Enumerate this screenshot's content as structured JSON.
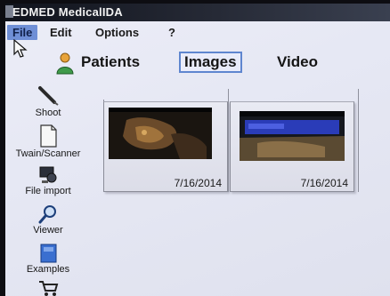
{
  "window": {
    "title": "EDMED MedicalIDA"
  },
  "menu": [
    {
      "label": "File"
    },
    {
      "label": "Edit"
    },
    {
      "label": "Options"
    },
    {
      "label": "?"
    }
  ],
  "tabs": [
    {
      "label": "Patients",
      "icon": "person-icon"
    },
    {
      "label": "Images",
      "active": true
    },
    {
      "label": "Video"
    }
  ],
  "sidebar": [
    {
      "label": "Shoot",
      "icon": "pen-icon"
    },
    {
      "label": "Twain/Scanner",
      "icon": "document-icon"
    },
    {
      "label": "File import",
      "icon": "import-icon"
    },
    {
      "label": "Viewer",
      "icon": "magnifier-icon"
    },
    {
      "label": "Examples",
      "icon": "book-icon"
    },
    {
      "label": "",
      "icon": "cart-icon"
    }
  ],
  "images": [
    {
      "date": "7/16/2014"
    },
    {
      "date": "7/16/2014"
    }
  ],
  "colors": {
    "accent": "#5f86cf",
    "menu_highlight": "#6f8fd6",
    "titlebar": "#10131c"
  }
}
